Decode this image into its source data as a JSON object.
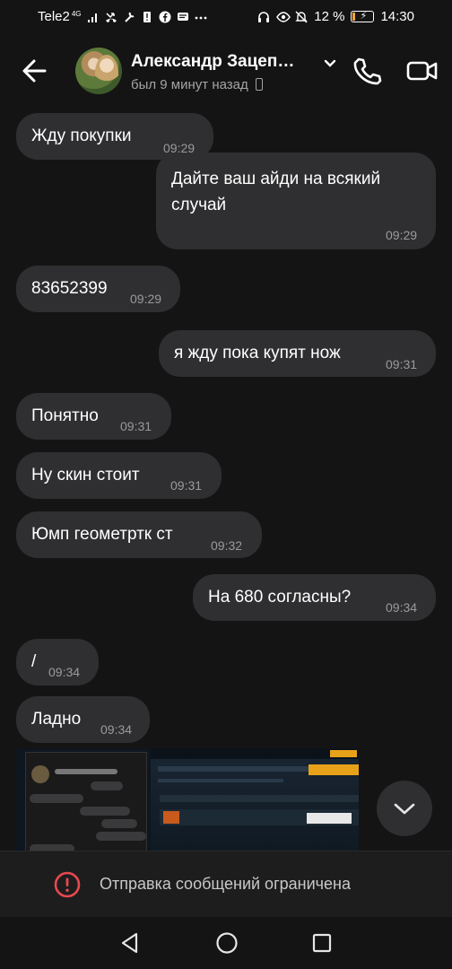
{
  "status_bar": {
    "carrier": "Tele2",
    "network": "4G",
    "battery_percent": "12 %",
    "time": "14:30"
  },
  "header": {
    "contact_name": "Александр Зацеп…",
    "last_seen": "был 9 минут назад"
  },
  "messages": [
    {
      "side": "in",
      "text": "Жду покупки",
      "time": "09:29"
    },
    {
      "side": "out",
      "text": "Дайте ваш айди на всякий случай",
      "time": "09:29"
    },
    {
      "side": "in",
      "text": "83652399",
      "time": "09:29"
    },
    {
      "side": "out",
      "text": "я жду пока купят нож",
      "time": "09:31"
    },
    {
      "side": "in",
      "text": "Понятно",
      "time": "09:31"
    },
    {
      "side": "in",
      "text": "Ну скин стоит",
      "time": "09:31"
    },
    {
      "side": "in",
      "text": "Юмп геометртк ст",
      "time": "09:32"
    },
    {
      "side": "out",
      "text": "На 680 согласны?",
      "time": "09:34"
    },
    {
      "side": "in",
      "text": "/",
      "time": "09:34"
    },
    {
      "side": "in",
      "text": "Ладно",
      "time": "09:34"
    }
  ],
  "banner": {
    "text": "Отправка сообщений ограничена"
  },
  "icons": {
    "back": "arrow-left-icon",
    "call": "phone-icon",
    "video": "video-camera-icon",
    "warning": "alert-circle-icon",
    "scroll": "chevron-down-icon"
  },
  "colors": {
    "background": "#141414",
    "bubble": "#2f2f31",
    "warning": "#e8484d",
    "battery": "#f2a33a"
  }
}
